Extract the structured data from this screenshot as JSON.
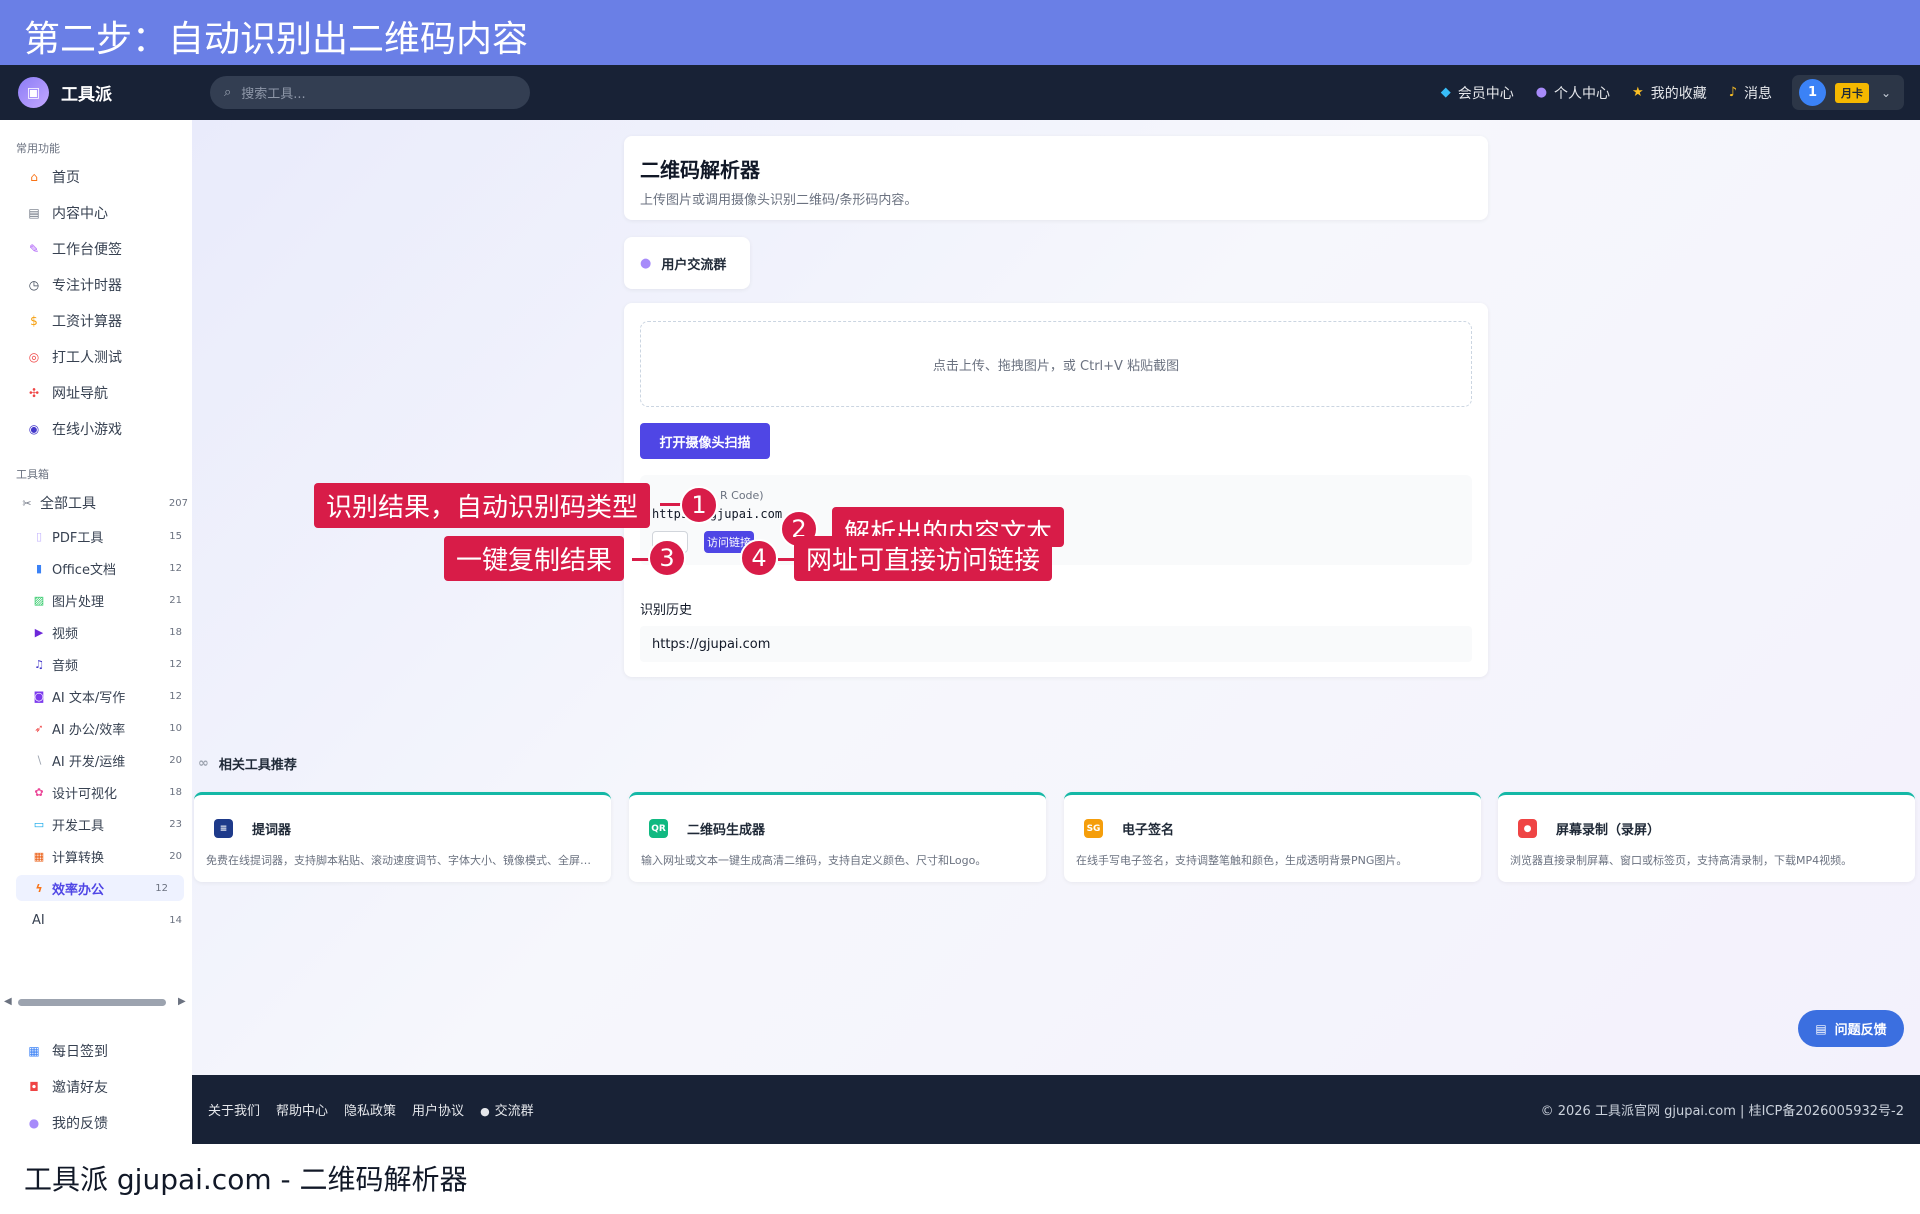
{
  "banner": {
    "text": "第二步：自动识别出二维码内容"
  },
  "nav": {
    "brand": "工具派",
    "search_placeholder": "搜索工具...",
    "links": [
      "会员中心",
      "个人中心",
      "我的收藏",
      "消息"
    ],
    "user_number": "1",
    "badge": "月卡"
  },
  "sidebar": {
    "common_title": "常用功能",
    "common": [
      {
        "label": "首页",
        "icon": "house-icon"
      },
      {
        "label": "内容中心",
        "icon": "newspaper-icon"
      },
      {
        "label": "工作台便签",
        "icon": "memo-icon"
      },
      {
        "label": "专注计时器",
        "icon": "stopwatch-icon"
      },
      {
        "label": "工资计算器",
        "icon": "money-bag-icon"
      },
      {
        "label": "打工人测试",
        "icon": "target-icon"
      },
      {
        "label": "网址导航",
        "icon": "compass-icon"
      },
      {
        "label": "在线小游戏",
        "icon": "gamepad-icon"
      }
    ],
    "toolbox_title": "工具箱",
    "all_tools": {
      "label": "全部工具",
      "count": "207"
    },
    "categories": [
      {
        "label": "PDF工具",
        "count": "15"
      },
      {
        "label": "Office文档",
        "count": "12"
      },
      {
        "label": "图片处理",
        "count": "21"
      },
      {
        "label": "视频",
        "count": "18"
      },
      {
        "label": "音频",
        "count": "12"
      },
      {
        "label": "AI 文本/写作",
        "count": "12"
      },
      {
        "label": "AI 办公/效率",
        "count": "10"
      },
      {
        "label": "AI 开发/运维",
        "count": "20"
      },
      {
        "label": "设计可视化",
        "count": "18"
      },
      {
        "label": "开发工具",
        "count": "23"
      },
      {
        "label": "计算转换",
        "count": "20"
      },
      {
        "label": "效率办公",
        "count": "12"
      },
      {
        "label": "AI",
        "count": "14"
      }
    ],
    "bottom": [
      {
        "label": "每日签到",
        "icon": "calendar-icon"
      },
      {
        "label": "邀请好友",
        "icon": "gift-icon"
      },
      {
        "label": "我的反馈",
        "icon": "chat-icon"
      }
    ]
  },
  "tool": {
    "title": "二维码解析器",
    "subtitle": "上传图片或调用摄像头识别二维码/条形码内容。",
    "group_label": "用户交流群",
    "drop_text": "点击上传、拖拽图片，或 Ctrl+V 粘贴截图",
    "scan_button": "打开摄像头扫描",
    "result_type": "R Code)",
    "result_text": "https://gjupai.com",
    "visit_button": "访问链接",
    "history_label": "识别历史",
    "history": [
      "https://gjupai.com"
    ]
  },
  "related": {
    "title": "相关工具推荐",
    "items": [
      {
        "title": "提词器",
        "icon_text": "≡",
        "color": "#1e3a8a",
        "desc": "免费在线提词器，支持脚本粘贴、滚动速度调节、字体大小、镜像模式、全屏显示"
      },
      {
        "title": "二维码生成器",
        "icon_text": "QR",
        "color": "#10b981",
        "desc": "输入网址或文本一键生成高清二维码，支持自定义颜色、尺寸和Logo。"
      },
      {
        "title": "电子签名",
        "icon_text": "SG",
        "color": "#f59e0b",
        "desc": "在线手写电子签名，支持调整笔触和颜色，生成透明背景PNG图片。"
      },
      {
        "title": "屏幕录制（录屏）",
        "icon_text": "●",
        "color": "#ef4444",
        "desc": "浏览器直接录制屏幕、窗口或标签页，支持高清录制，下载MP4视频。"
      }
    ]
  },
  "feedback": "问题反馈",
  "footer": {
    "links": [
      "关于我们",
      "帮助中心",
      "隐私政策",
      "用户协议",
      "交流群"
    ],
    "copyright": "© 2026 工具派官网 gjupai.com | 桂ICP备2026005932号-2"
  },
  "caption": "工具派 gjupai.com - 二维码解析器",
  "annotations": [
    {
      "n": "1",
      "text": "识别结果，自动识别码类型"
    },
    {
      "n": "2",
      "text": "解析出的内容文本"
    },
    {
      "n": "3",
      "text": "一键复制结果"
    },
    {
      "n": "4",
      "text": "网址可直接访问链接"
    }
  ]
}
